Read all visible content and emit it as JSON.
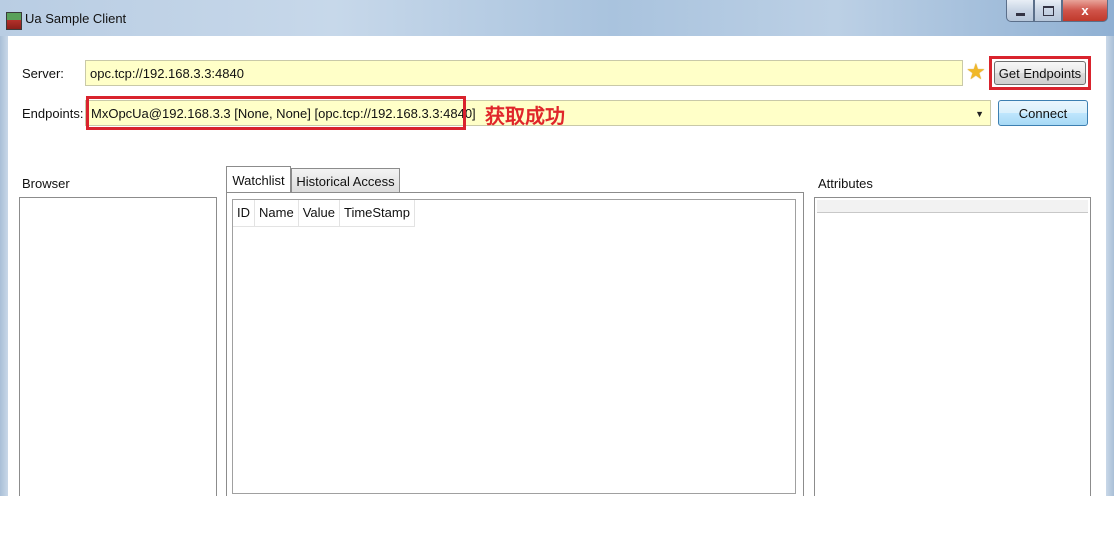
{
  "window": {
    "title": "Ua Sample Client",
    "close_glyph": "x",
    "icons": {
      "app": "app-icon",
      "minimize": "minimize-icon",
      "maximize": "maximize-icon",
      "close": "close-icon",
      "favorite": "star-icon",
      "dropdown": "chevron-down-icon"
    }
  },
  "server": {
    "label": "Server:",
    "value": "opc.tcp://192.168.3.3:4840",
    "get_endpoints_label": "Get Endpoints"
  },
  "endpoints": {
    "label": "Endpoints:",
    "selected": "MxOpcUa@192.168.3.3 [None, None] [opc.tcp://192.168.3.3:4840]",
    "annotation": "获取成功",
    "connect_label": "Connect"
  },
  "browser": {
    "title": "Browser"
  },
  "tabs": [
    {
      "label": "Watchlist",
      "active": true
    },
    {
      "label": "Historical Access",
      "active": false
    }
  ],
  "watchlist": {
    "columns": [
      "ID",
      "Name",
      "Value",
      "TimeStamp"
    ]
  },
  "attributes": {
    "title": "Attributes"
  },
  "colors": {
    "highlight": "#d9232d",
    "input_background": "#ffffc8",
    "annotation": "#e0262a"
  }
}
